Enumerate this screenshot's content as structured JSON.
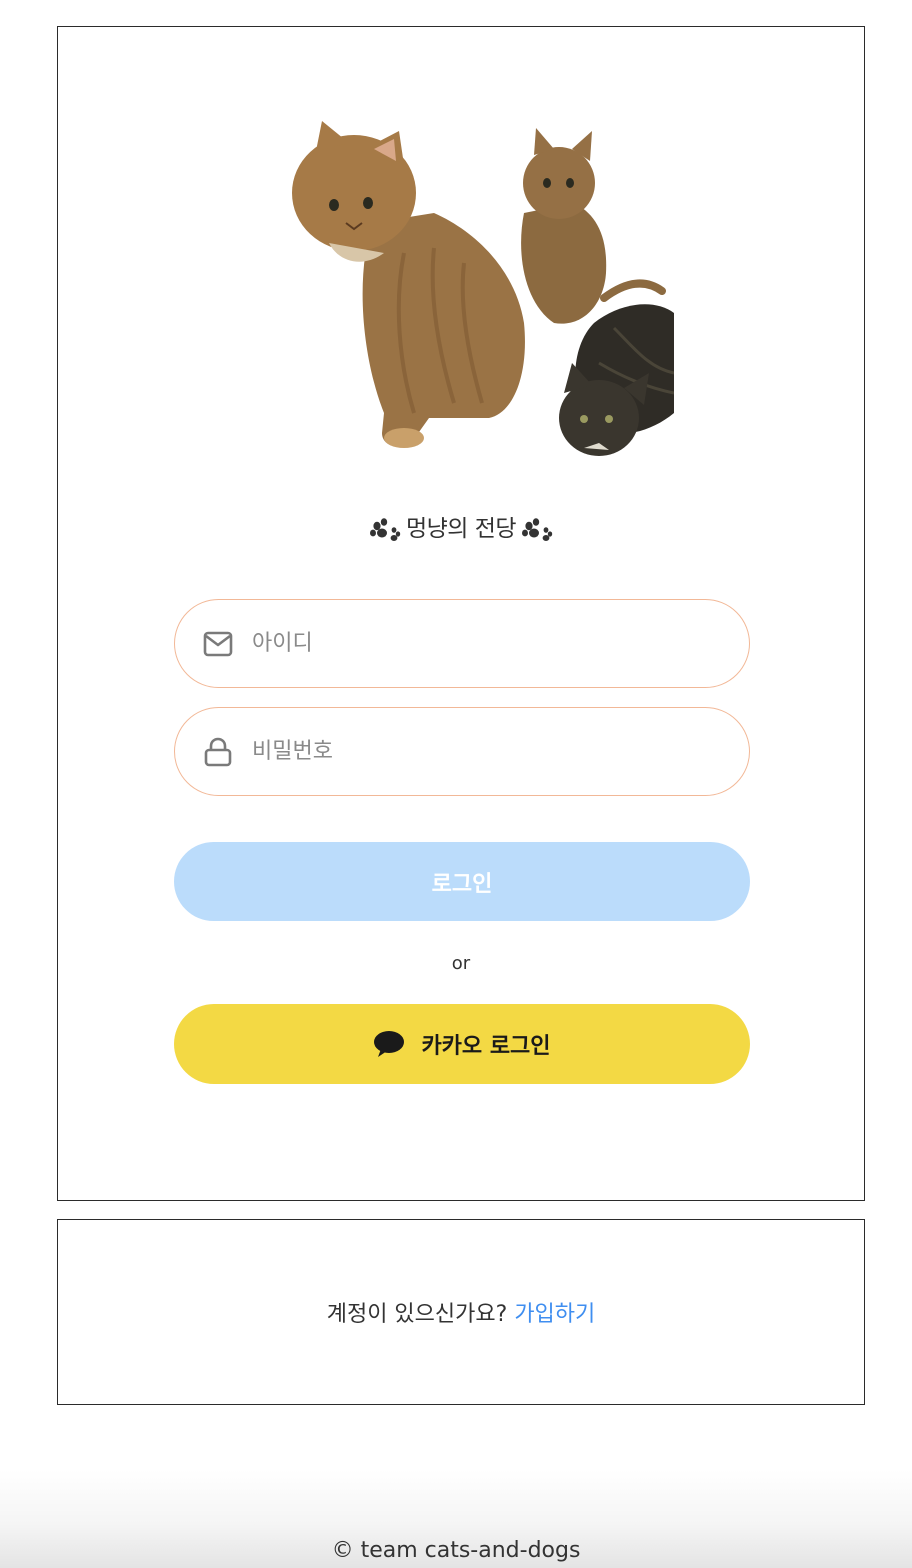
{
  "brand": {
    "title": "멍냥의 전당",
    "left_icon": "paw-icon",
    "right_icon": "paw-icon"
  },
  "hero_image": {
    "name": "cats-photo"
  },
  "login_form": {
    "id_icon": "mail-icon",
    "id_placeholder": "아이디",
    "id_value": "",
    "password_icon": "lock-icon",
    "password_placeholder": "비밀번호",
    "password_value": "",
    "login_button_label": "로그인",
    "divider_text": "or",
    "kakao_button_label": "카카오 로그인",
    "kakao_icon": "speech-bubble-icon"
  },
  "signup": {
    "prompt": "계정이 있으신가요?",
    "link_label": "가입하기"
  },
  "footer": {
    "copyright": "© team cats-and-dogs"
  },
  "colors": {
    "field_border": "#f2b897",
    "login_button": "#bbdcfb",
    "kakao_button": "#f3d944",
    "signup_link": "#3f8ef0",
    "text": "#333333"
  }
}
